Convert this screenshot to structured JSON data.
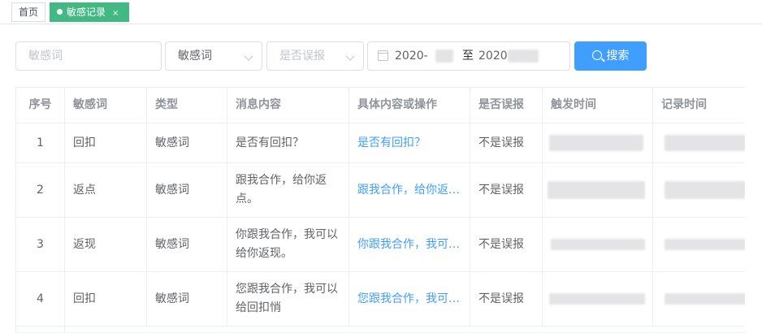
{
  "tabs": {
    "home": "首页",
    "active": "敏感记录",
    "close": "×"
  },
  "filters": {
    "keyword_placeholder": "敏感词",
    "type_value": "敏感词",
    "misreport_placeholder": "是否误报",
    "date_start": "2020-",
    "date_sep": "至",
    "date_end": "2020",
    "search_label": "搜索"
  },
  "table": {
    "headers": [
      "序号",
      "敏感词",
      "类型",
      "消息内容",
      "具体内容或操作",
      "是否误报",
      "触发时间",
      "记录时间"
    ],
    "rows": [
      {
        "index": "1",
        "word": "回扣",
        "type": "敏感词",
        "message": "是否有回扣？",
        "detail": "是否有回扣？",
        "misreport": "不是误报"
      },
      {
        "index": "2",
        "word": "返点",
        "type": "敏感词",
        "message": "跟我合作，给你返点。",
        "detail": "跟我合作，给你返点。",
        "misreport": "不是误报"
      },
      {
        "index": "3",
        "word": "返现",
        "type": "敏感词",
        "message": "你跟我合作，我可以给你返现。",
        "detail": "你跟我合作，我可以给你返现。",
        "misreport": "不是误报"
      },
      {
        "index": "4",
        "word": "回扣",
        "type": "敏感词",
        "message": "您跟我合作，我可以给回扣悄",
        "detail": "您跟我合作，我可以给回扣悄",
        "misreport": "不是误报"
      }
    ]
  },
  "colors": {
    "accent": "#409eff",
    "tab_active": "#42b983",
    "border": "#ebeef5"
  }
}
